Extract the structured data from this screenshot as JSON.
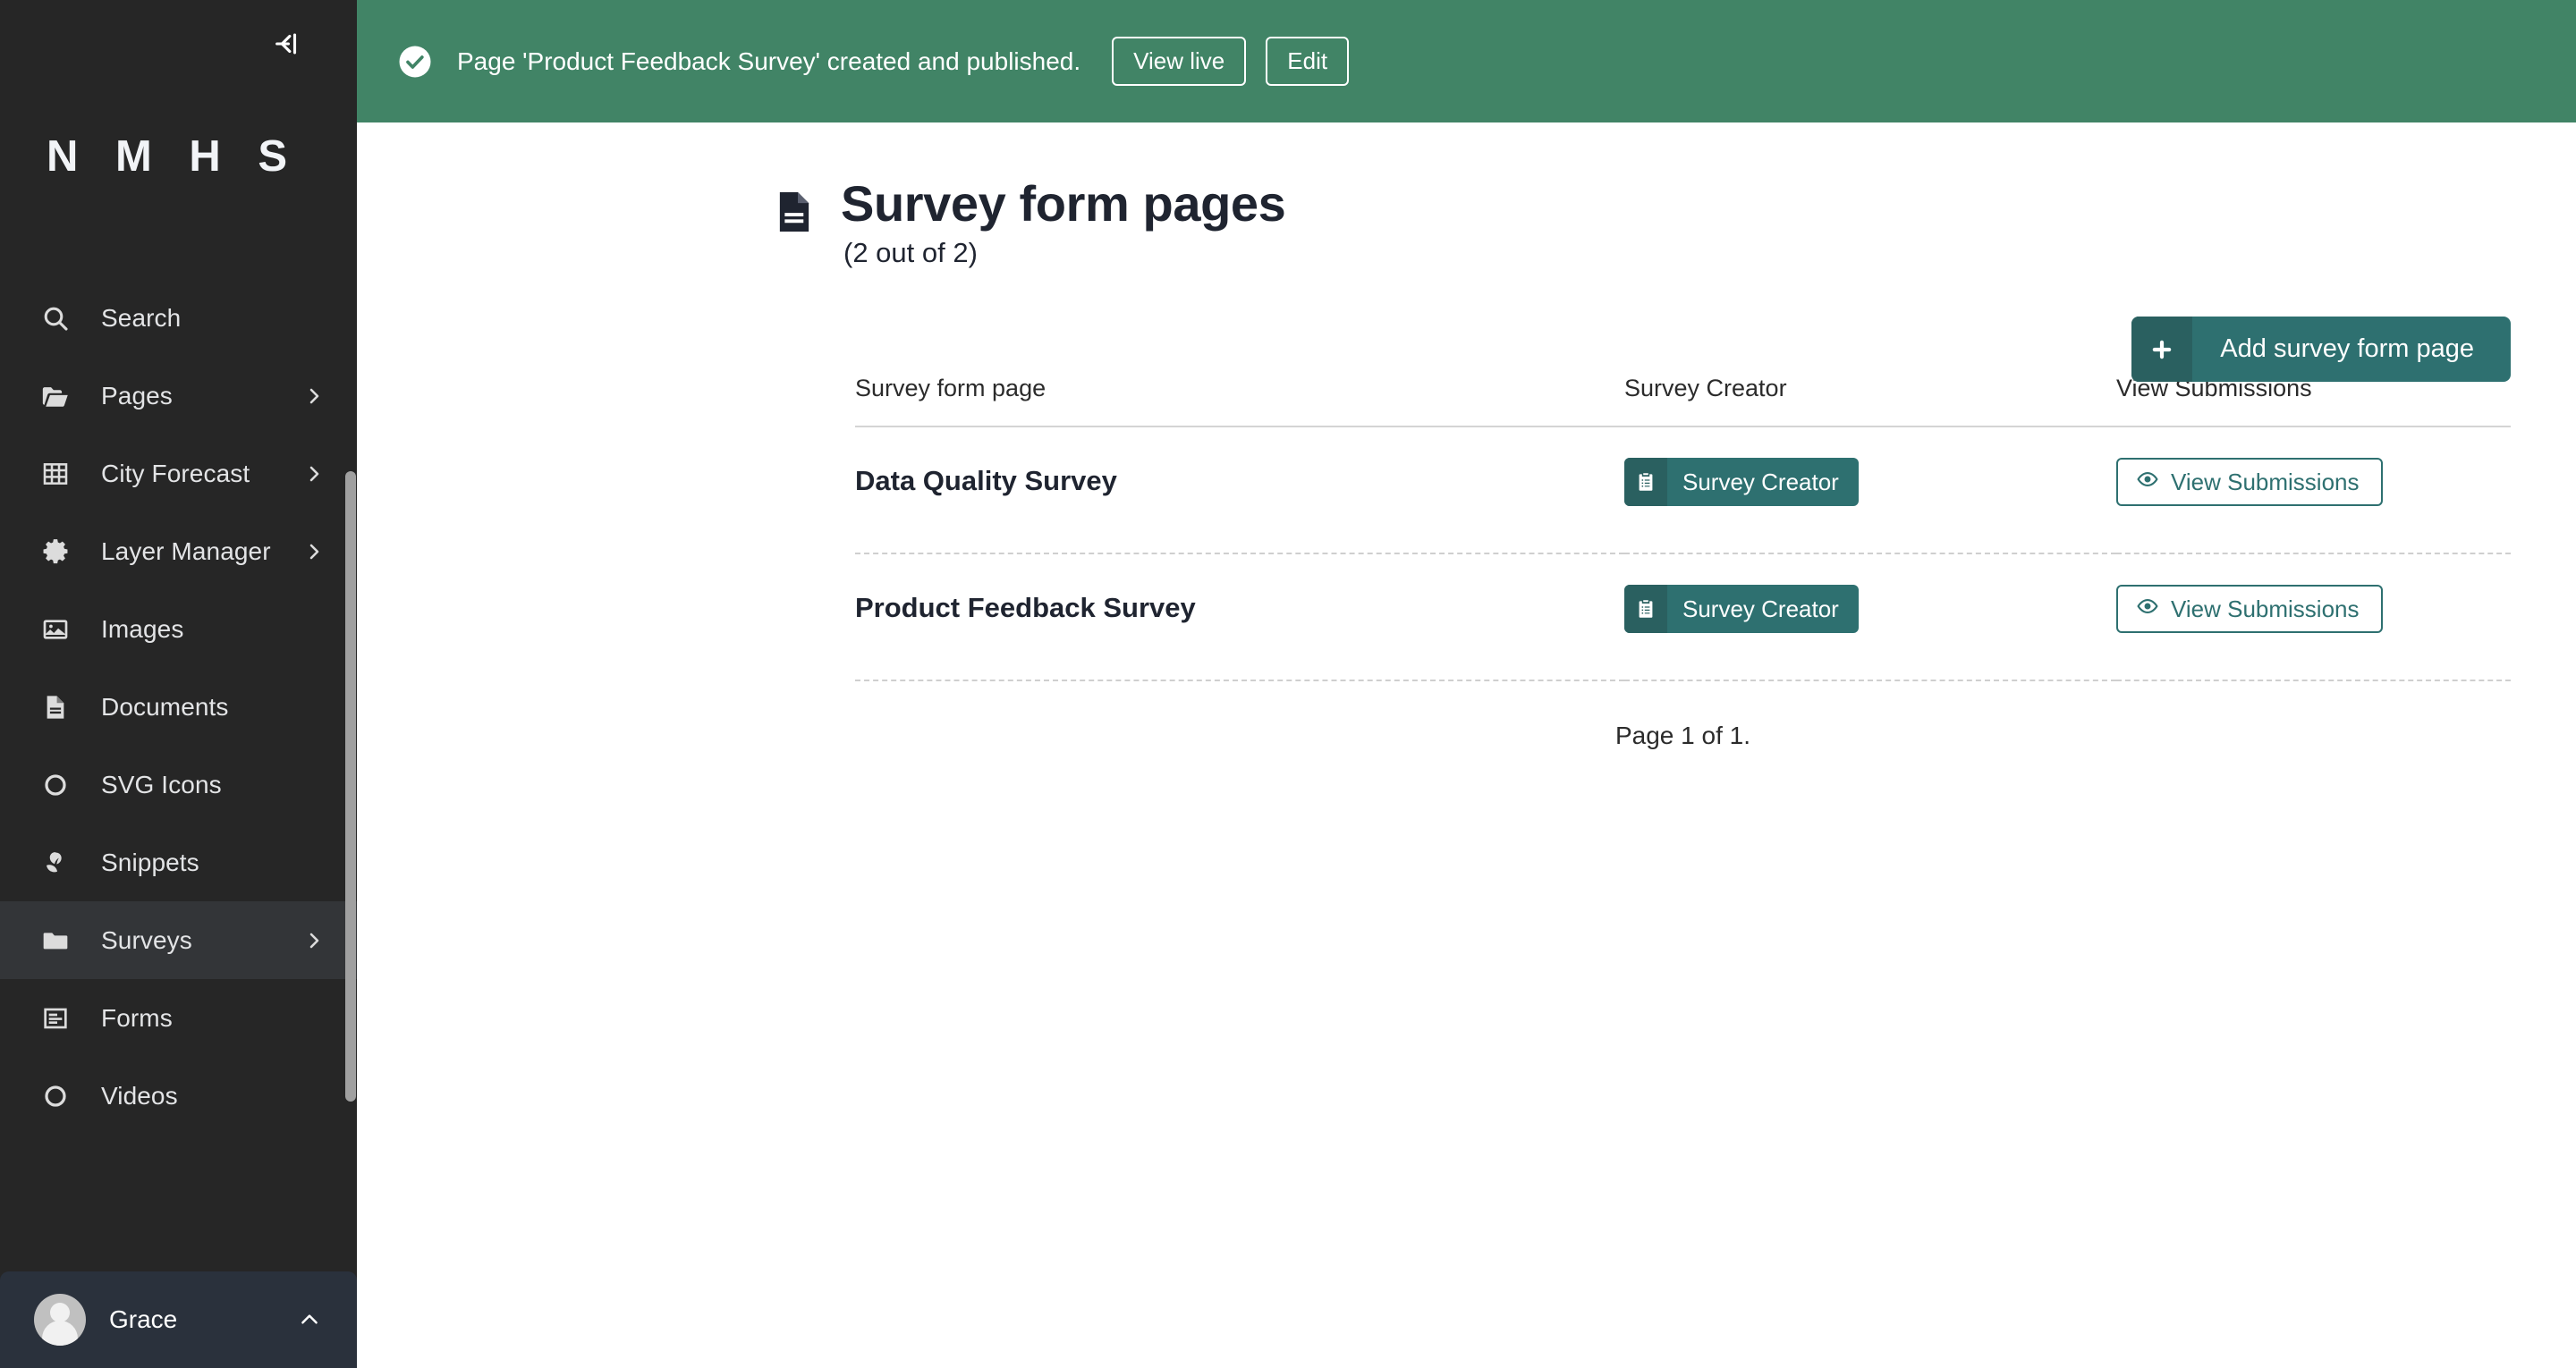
{
  "sidebar": {
    "collapse_icon": "collapse-left-icon",
    "brand": "N M H S",
    "footer": {
      "name": "Grace",
      "avatar_icon": "user-avatar-icon",
      "chevron_icon": "chevron-up-icon"
    },
    "items": [
      {
        "label": "Search",
        "icon": "search-icon",
        "expandable": false,
        "active": false
      },
      {
        "label": "Pages",
        "icon": "folder-open-icon",
        "expandable": true,
        "active": false
      },
      {
        "label": "City Forecast",
        "icon": "table-icon",
        "expandable": true,
        "active": false
      },
      {
        "label": "Layer Manager",
        "icon": "gear-icon",
        "expandable": true,
        "active": false
      },
      {
        "label": "Images",
        "icon": "image-icon",
        "expandable": false,
        "active": false
      },
      {
        "label": "Documents",
        "icon": "document-icon",
        "expandable": false,
        "active": false
      },
      {
        "label": "SVG Icons",
        "icon": "circle-icon",
        "expandable": false,
        "active": false
      },
      {
        "label": "Snippets",
        "icon": "snippet-leaf-icon",
        "expandable": false,
        "active": false
      },
      {
        "label": "Surveys",
        "icon": "folder-icon",
        "expandable": true,
        "active": true
      },
      {
        "label": "Forms",
        "icon": "form-icon",
        "expandable": false,
        "active": false
      },
      {
        "label": "Videos",
        "icon": "circle-icon",
        "expandable": false,
        "active": false
      }
    ]
  },
  "banner": {
    "icon": "success-check-icon",
    "message": "Page 'Product Feedback Survey' created and published.",
    "view_live_label": "View live",
    "edit_label": "Edit",
    "background": "#418466"
  },
  "header": {
    "icon": "document-page-icon",
    "title": "Survey form pages",
    "subtitle": "(2 out of 2)",
    "add_button": {
      "label": "Add survey form page",
      "icon": "plus-icon",
      "background": "#2e7070"
    }
  },
  "table": {
    "columns": [
      "Survey form page",
      "Survey Creator",
      "View Submissions"
    ],
    "rows": [
      {
        "name": "Data Quality Survey",
        "creator_button": {
          "label": "Survey Creator",
          "icon": "clipboard-list-icon"
        },
        "submissions_button": {
          "label": "View Submissions",
          "icon": "eye-icon"
        }
      },
      {
        "name": "Product Feedback Survey",
        "creator_button": {
          "label": "Survey Creator",
          "icon": "clipboard-list-icon"
        },
        "submissions_button": {
          "label": "View Submissions",
          "icon": "eye-icon"
        }
      }
    ]
  },
  "pagination": {
    "text": "Page 1 of 1."
  },
  "colors": {
    "sidebar_bg": "#262626",
    "sidebar_active": "#333538",
    "sidebar_footer_bg": "#2a313c",
    "banner_green": "#418466",
    "teal": "#2e7070",
    "teal_dark": "#2a6060",
    "title_text": "#1f2430"
  }
}
